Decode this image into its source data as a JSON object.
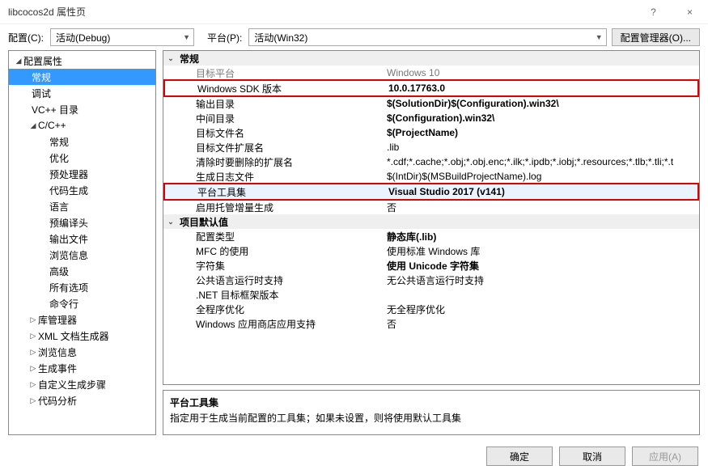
{
  "window": {
    "title": "libcocos2d 属性页",
    "help_icon": "?",
    "close_icon": "×"
  },
  "toolbar": {
    "config_label": "配置(C):",
    "config_value": "活动(Debug)",
    "platform_label": "平台(P):",
    "platform_value": "活动(Win32)",
    "config_mgr": "配置管理器(O)..."
  },
  "tree": {
    "root": "配置属性",
    "items": [
      "常规",
      "调试",
      "VC++ 目录"
    ],
    "cpp": "C/C++",
    "cpp_children": [
      "常规",
      "优化",
      "预处理器",
      "代码生成",
      "语言",
      "预编译头",
      "输出文件",
      "浏览信息",
      "高级",
      "所有选项",
      "命令行"
    ],
    "rest": [
      "库管理器",
      "XML 文档生成器",
      "浏览信息",
      "生成事件",
      "自定义生成步骤",
      "代码分析"
    ]
  },
  "grid": {
    "section1": "常规",
    "rows1": [
      {
        "l": "目标平台",
        "v": "Windows 10",
        "gray": true
      },
      {
        "l": "Windows SDK 版本",
        "v": "10.0.17763.0",
        "bold": true,
        "red": true
      },
      {
        "l": "输出目录",
        "v": "$(SolutionDir)$(Configuration).win32\\",
        "bold": true
      },
      {
        "l": "中间目录",
        "v": "$(Configuration).win32\\",
        "bold": true
      },
      {
        "l": "目标文件名",
        "v": "$(ProjectName)",
        "bold": true
      },
      {
        "l": "目标文件扩展名",
        "v": ".lib"
      },
      {
        "l": "清除时要删除的扩展名",
        "v": "*.cdf;*.cache;*.obj;*.obj.enc;*.ilk;*.ipdb;*.iobj;*.resources;*.tlb;*.tli;*.t"
      },
      {
        "l": "生成日志文件",
        "v": "$(IntDir)$(MSBuildProjectName).log"
      },
      {
        "l": "平台工具集",
        "v": "Visual Studio 2017 (v141)",
        "bold": true,
        "red": true,
        "sel": true
      },
      {
        "l": "启用托管增量生成",
        "v": "否"
      }
    ],
    "section2": "项目默认值",
    "rows2": [
      {
        "l": "配置类型",
        "v": "静态库(.lib)",
        "bold": true
      },
      {
        "l": "MFC 的使用",
        "v": "使用标准 Windows 库"
      },
      {
        "l": "字符集",
        "v": "使用 Unicode 字符集",
        "bold": true
      },
      {
        "l": "公共语言运行时支持",
        "v": "无公共语言运行时支持"
      },
      {
        "l": ".NET 目标框架版本",
        "v": ""
      },
      {
        "l": "全程序优化",
        "v": "无全程序优化"
      },
      {
        "l": "Windows 应用商店应用支持",
        "v": "否"
      }
    ]
  },
  "desc": {
    "title": "平台工具集",
    "text": "指定用于生成当前配置的工具集；如果未设置，则将使用默认工具集"
  },
  "footer": {
    "ok": "确定",
    "cancel": "取消",
    "apply": "应用(A)"
  }
}
